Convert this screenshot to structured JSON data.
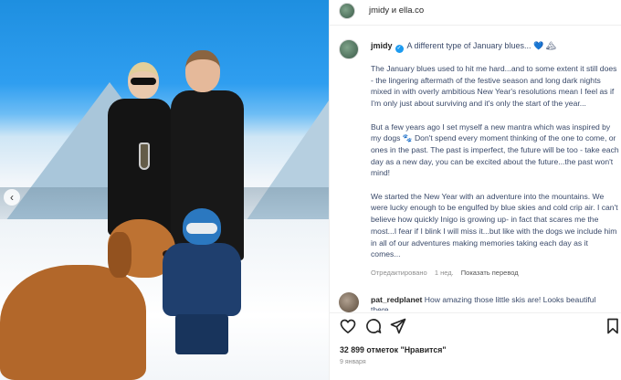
{
  "header": {
    "title": "jmidy и ella.co"
  },
  "post": {
    "username": "jmidy",
    "first_line": "A different type of January blues... 💙 🏔",
    "paragraphs": [
      "The January blues used to hit me hard...and to some extent it still does - the lingering aftermath of the festive season and long dark nights mixed in with overly ambitious New Year's resolutions mean I feel as if I'm only just about surviving and it's only the start of the year...",
      "But a few years ago I set myself a new mantra which was inspired by my dogs 🐾 Don't spend every moment thinking of the one to come, or ones in the past. The past is imperfect, the future will be too - take each day as a new day, you can be excited about the future...the past won't mind!",
      "We started the New Year with an adventure into the mountains. We were lucky enough to be engulfed by blue skies and cold crip air. I can't believe how quickly Inigo is growing up- in fact that scares me the most...I fear if I blink I will miss it...but like with the dogs we include him in all of our adventures making memories taking each day as it comes..."
    ],
    "meta": {
      "edited": "Отредактировано",
      "age": "1 нед.",
      "translate": "Показать перевод"
    }
  },
  "comment": {
    "username": "pat_redplanet",
    "text": "How amazing those little skis are! Looks beautiful there"
  },
  "footer": {
    "likes_count": "32 899",
    "likes_suffix": "отметок \"Нравится\"",
    "date": "9 января"
  },
  "icons": {
    "like": "heart-icon",
    "comment": "comment-icon",
    "share": "share-icon",
    "save": "bookmark-icon",
    "verified": "verified-badge-icon",
    "carousel": "chevron-left-icon"
  },
  "colors": {
    "verified": "#1d9bf0",
    "text": "#262626",
    "secondary": "#8e8e8e",
    "caption": "#3a4a6a"
  }
}
